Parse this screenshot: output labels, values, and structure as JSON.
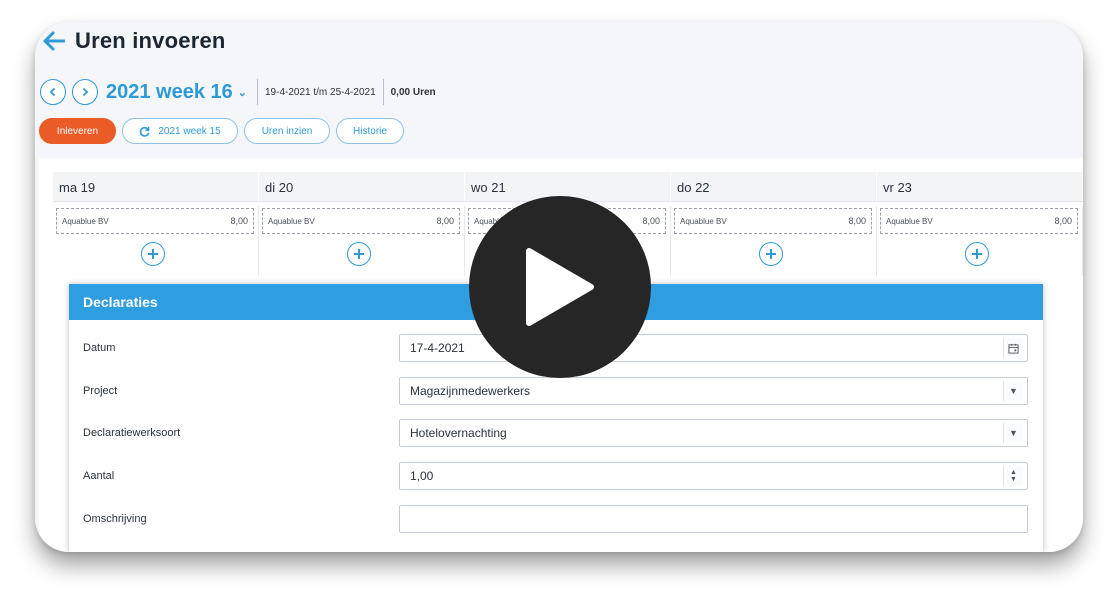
{
  "header": {
    "title": "Uren invoeren"
  },
  "week": {
    "label": "2021 week 16",
    "range": "19-4-2021 t/m 25-4-2021",
    "hours": "0,00 Uren"
  },
  "actions": {
    "submit": "Inleveren",
    "previous_week": "2021 week 15",
    "view_hours": "Uren inzien",
    "history": "Historie"
  },
  "days": [
    {
      "label": "ma 19",
      "client": "Aquablue BV",
      "value": "8,00"
    },
    {
      "label": "di 20",
      "client": "Aquablue BV",
      "value": "8,00"
    },
    {
      "label": "wo 21",
      "client": "Aquablue BV",
      "value": "8,00"
    },
    {
      "label": "do 22",
      "client": "Aquablue BV",
      "value": "8,00"
    },
    {
      "label": "vr 23",
      "client": "Aquablue BV",
      "value": "8,00"
    }
  ],
  "declaraties": {
    "title": "Declaraties",
    "fields": [
      {
        "label": "Datum",
        "value": "17-4-2021",
        "control": "calendar-icon"
      },
      {
        "label": "Project",
        "value": "Magazijnmedewerkers",
        "control": "caret-down-icon"
      },
      {
        "label": "Declaratiewerksoort",
        "value": "Hotelovernachting",
        "control": "caret-down-icon"
      },
      {
        "label": "Aantal",
        "value": "1,00",
        "control": "stepper-icon"
      },
      {
        "label": "Omschrijving",
        "value": "",
        "control": ""
      }
    ]
  },
  "colors": {
    "accent": "#2f9ad8",
    "header_bar": "#2f9ee0",
    "primary_button": "#ea5b25",
    "play_overlay": "#262626"
  }
}
